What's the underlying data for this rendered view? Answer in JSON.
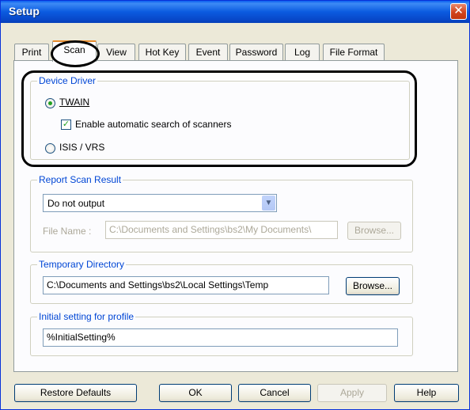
{
  "window": {
    "title": "Setup",
    "close_glyph": "✕"
  },
  "tabs": [
    {
      "label": "Print"
    },
    {
      "label": "Scan"
    },
    {
      "label": "View"
    },
    {
      "label": "Hot Key"
    },
    {
      "label": "Event"
    },
    {
      "label": "Password"
    },
    {
      "label": "Log"
    },
    {
      "label": "File Format"
    }
  ],
  "device_driver": {
    "legend": "Device Driver",
    "twain_label": "TWAIN",
    "auto_search_label": "Enable automatic search of scanners",
    "auto_search_checked": true,
    "isis_label": "ISIS / VRS",
    "selected": "TWAIN"
  },
  "report": {
    "legend": "Report Scan Result",
    "selected_option": "Do not output",
    "file_name_label": "File Name :",
    "file_name_value": "C:\\Documents and Settings\\bs2\\My Documents\\",
    "browse_label": "Browse..."
  },
  "temp_dir": {
    "legend": "Temporary Directory",
    "value": "C:\\Documents and Settings\\bs2\\Local Settings\\Temp",
    "browse_label": "Browse..."
  },
  "initial": {
    "legend": "Initial setting for profile",
    "value": "%InitialSetting%"
  },
  "buttons": {
    "restore": "Restore Defaults",
    "ok": "OK",
    "cancel": "Cancel",
    "apply": "Apply",
    "help": "Help"
  },
  "icons": {
    "combo_arrow": "chevron-down-icon",
    "check": "checkmark-icon"
  }
}
